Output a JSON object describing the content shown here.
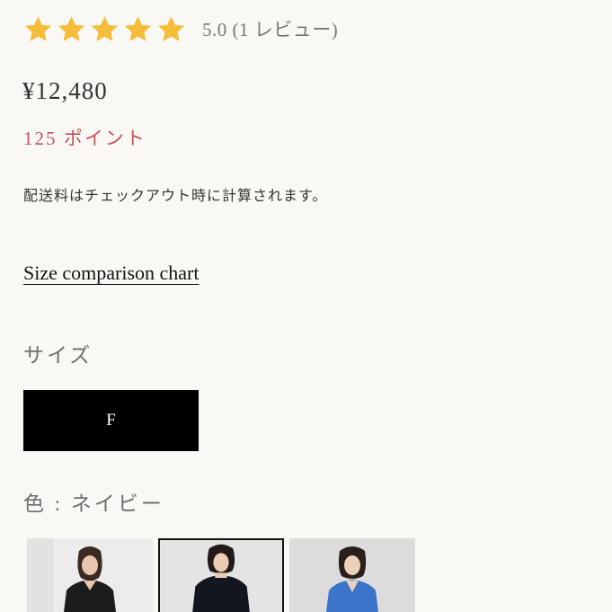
{
  "rating": {
    "stars": 5,
    "max_stars": 5,
    "text": "5.0 (1 レビュー)",
    "star_color": "#f6bd3b",
    "star_icon": "star-icon"
  },
  "price": "¥12,480",
  "points": "125 ポイント",
  "points_color": "#c0555b",
  "shipping_note": "配送料はチェックアウト時に計算されます。",
  "size_chart_link": "Size comparison chart",
  "size": {
    "label": "サイズ",
    "options": [
      "F"
    ],
    "selected": "F"
  },
  "color": {
    "label": "色 : ネイビー",
    "swatches": [
      {
        "name": "black",
        "selected": false
      },
      {
        "name": "navy",
        "selected": true
      },
      {
        "name": "blue",
        "selected": false
      }
    ]
  }
}
